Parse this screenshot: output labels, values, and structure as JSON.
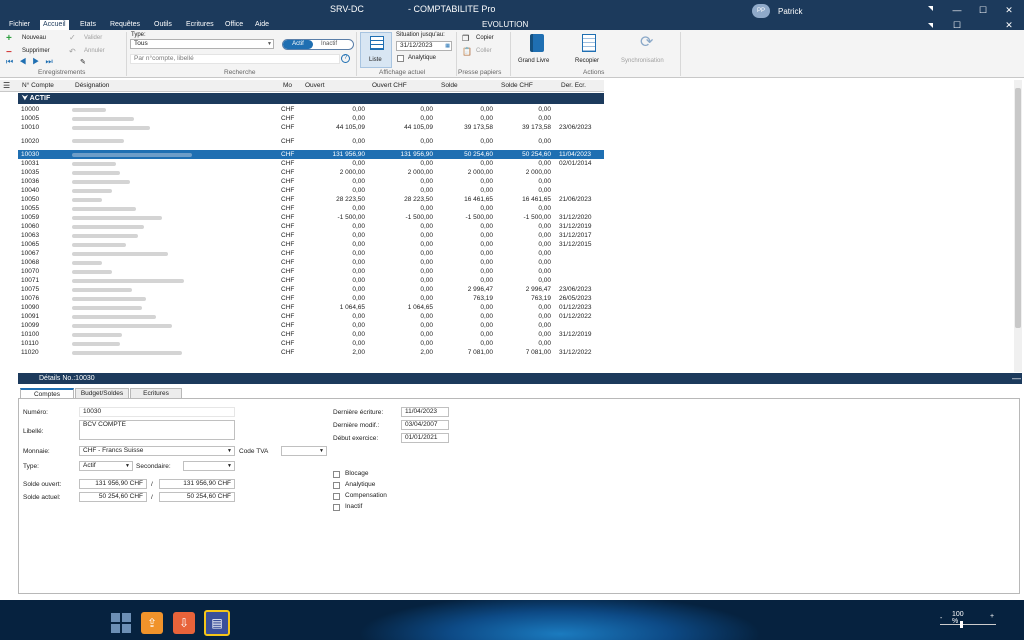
{
  "titlebar": {
    "server": "SRV-DC",
    "app_title": "- COMPTABILITE Pro",
    "user_initials": "PP",
    "user_name": "Patrick"
  },
  "menu": {
    "items": [
      "Fichier",
      "Accueil",
      "Etats",
      "Requêtes",
      "Outils",
      "Ecritures",
      "Office",
      "Aide"
    ],
    "active": "Accueil",
    "context": "EVOLUTION"
  },
  "ribbon": {
    "nouveau": "Nouveau",
    "supprimer": "Supprimer",
    "valider": "Valider",
    "annuler": "Annuler",
    "type_label": "Type:",
    "type_value": "Tous",
    "search_placeholder": "Par n°compte, libellé",
    "toggle_on": "Actif",
    "toggle_off": "Inactif",
    "liste": "Liste",
    "situation_label": "Situation jusqu'au:",
    "situation_date": "31/12/2023",
    "analytique": "Analytique",
    "copier": "Copier",
    "coller": "Coller",
    "grand_livre": "Grand Livre",
    "recopier": "Recopier",
    "synchronisation": "Synchronisation",
    "groups": {
      "enregistrements": "Enregistrements",
      "recherche": "Recherche",
      "affichage": "Affichage actuel",
      "presse": "Presse papiers",
      "actions": "Actions"
    }
  },
  "grid": {
    "columns": [
      "N° Compte",
      "Désignation",
      "Mo",
      "Ouvert",
      "Ouvert CHF",
      "Solde",
      "Solde CHF",
      "Der. Ecr."
    ],
    "group": "ACTIF",
    "rows": [
      {
        "num": "10000",
        "mo": "CHF",
        "ouvert": "0,00",
        "ouvert_chf": "0,00",
        "solde": "0,00",
        "solde_chf": "0,00",
        "der": ""
      },
      {
        "num": "10005",
        "mo": "CHF",
        "ouvert": "0,00",
        "ouvert_chf": "0,00",
        "solde": "0,00",
        "solde_chf": "0,00",
        "der": ""
      },
      {
        "num": "10010",
        "mo": "CHF",
        "ouvert": "44 105,09",
        "ouvert_chf": "44 105,09",
        "solde": "39 173,58",
        "solde_chf": "39 173,58",
        "der": "23/06/2023"
      },
      {
        "num": "10020",
        "mo": "CHF",
        "ouvert": "0,00",
        "ouvert_chf": "0,00",
        "solde": "0,00",
        "solde_chf": "0,00",
        "der": ""
      },
      {
        "num": "10030",
        "mo": "CHF",
        "ouvert": "131 956,90",
        "ouvert_chf": "131 956,90",
        "solde": "50 254,60",
        "solde_chf": "50 254,60",
        "der": "11/04/2023",
        "selected": true
      },
      {
        "num": "10031",
        "mo": "CHF",
        "ouvert": "0,00",
        "ouvert_chf": "0,00",
        "solde": "0,00",
        "solde_chf": "0,00",
        "der": "02/01/2014"
      },
      {
        "num": "10035",
        "mo": "CHF",
        "ouvert": "2 000,00",
        "ouvert_chf": "2 000,00",
        "solde": "2 000,00",
        "solde_chf": "2 000,00",
        "der": ""
      },
      {
        "num": "10036",
        "mo": "CHF",
        "ouvert": "0,00",
        "ouvert_chf": "0,00",
        "solde": "0,00",
        "solde_chf": "0,00",
        "der": ""
      },
      {
        "num": "10040",
        "mo": "CHF",
        "ouvert": "0,00",
        "ouvert_chf": "0,00",
        "solde": "0,00",
        "solde_chf": "0,00",
        "der": ""
      },
      {
        "num": "10050",
        "mo": "CHF",
        "ouvert": "28 223,50",
        "ouvert_chf": "28 223,50",
        "solde": "16 461,65",
        "solde_chf": "16 461,65",
        "der": "21/06/2023"
      },
      {
        "num": "10055",
        "mo": "CHF",
        "ouvert": "0,00",
        "ouvert_chf": "0,00",
        "solde": "0,00",
        "solde_chf": "0,00",
        "der": ""
      },
      {
        "num": "10059",
        "mo": "CHF",
        "ouvert": "-1 500,00",
        "ouvert_chf": "-1 500,00",
        "solde": "-1 500,00",
        "solde_chf": "-1 500,00",
        "der": "31/12/2020"
      },
      {
        "num": "10060",
        "mo": "CHF",
        "ouvert": "0,00",
        "ouvert_chf": "0,00",
        "solde": "0,00",
        "solde_chf": "0,00",
        "der": "31/12/2019"
      },
      {
        "num": "10063",
        "mo": "CHF",
        "ouvert": "0,00",
        "ouvert_chf": "0,00",
        "solde": "0,00",
        "solde_chf": "0,00",
        "der": "31/12/2017"
      },
      {
        "num": "10065",
        "mo": "CHF",
        "ouvert": "0,00",
        "ouvert_chf": "0,00",
        "solde": "0,00",
        "solde_chf": "0,00",
        "der": "31/12/2015"
      },
      {
        "num": "10067",
        "mo": "CHF",
        "ouvert": "0,00",
        "ouvert_chf": "0,00",
        "solde": "0,00",
        "solde_chf": "0,00",
        "der": ""
      },
      {
        "num": "10068",
        "mo": "CHF",
        "ouvert": "0,00",
        "ouvert_chf": "0,00",
        "solde": "0,00",
        "solde_chf": "0,00",
        "der": ""
      },
      {
        "num": "10070",
        "mo": "CHF",
        "ouvert": "0,00",
        "ouvert_chf": "0,00",
        "solde": "0,00",
        "solde_chf": "0,00",
        "der": ""
      },
      {
        "num": "10071",
        "mo": "CHF",
        "ouvert": "0,00",
        "ouvert_chf": "0,00",
        "solde": "0,00",
        "solde_chf": "0,00",
        "der": ""
      },
      {
        "num": "10075",
        "mo": "CHF",
        "ouvert": "0,00",
        "ouvert_chf": "0,00",
        "solde": "2 996,47",
        "solde_chf": "2 996,47",
        "der": "23/06/2023"
      },
      {
        "num": "10076",
        "mo": "CHF",
        "ouvert": "0,00",
        "ouvert_chf": "0,00",
        "solde": "763,19",
        "solde_chf": "763,19",
        "der": "26/05/2023"
      },
      {
        "num": "10090",
        "mo": "CHF",
        "ouvert": "1 064,65",
        "ouvert_chf": "1 064,65",
        "solde": "0,00",
        "solde_chf": "0,00",
        "der": "01/12/2023"
      },
      {
        "num": "10091",
        "mo": "CHF",
        "ouvert": "0,00",
        "ouvert_chf": "0,00",
        "solde": "0,00",
        "solde_chf": "0,00",
        "der": "01/12/2022"
      },
      {
        "num": "10099",
        "mo": "CHF",
        "ouvert": "0,00",
        "ouvert_chf": "0,00",
        "solde": "0,00",
        "solde_chf": "0,00",
        "der": ""
      },
      {
        "num": "10100",
        "mo": "CHF",
        "ouvert": "0,00",
        "ouvert_chf": "0,00",
        "solde": "0,00",
        "solde_chf": "0,00",
        "der": "31/12/2019"
      },
      {
        "num": "10110",
        "mo": "CHF",
        "ouvert": "0,00",
        "ouvert_chf": "0,00",
        "solde": "0,00",
        "solde_chf": "0,00",
        "der": ""
      },
      {
        "num": "11020",
        "mo": "CHF",
        "ouvert": "2,00",
        "ouvert_chf": "2,00",
        "solde": "7 081,00",
        "solde_chf": "7 081,00",
        "der": "31/12/2022"
      }
    ]
  },
  "details": {
    "header": "Détails No.:10030",
    "tabs": [
      "Comptes",
      "Budget/Soldes",
      "Ecritures"
    ],
    "numero_label": "Numéro:",
    "numero": "10030",
    "libelle_label": "Libellé:",
    "libelle": "BCV COMPTE",
    "monnaie_label": "Monnaie:",
    "monnaie": "CHF - Francs Suisse",
    "code_tva_label": "Code TVA",
    "type_label": "Type:",
    "type": "Actif",
    "secondaire_label": "Secondaire:",
    "solde_ouvert_label": "Solde ouvert:",
    "solde_ouvert_1": "131 956,90 CHF",
    "solde_ouvert_2": "131 956,90 CHF",
    "solde_actuel_label": "Solde actuel:",
    "solde_actuel_1": "50 254,60 CHF",
    "solde_actuel_2": "50 254,60 CHF",
    "slash": "/",
    "derniere_ecriture_label": "Dernière écriture:",
    "derniere_ecriture": "11/04/2023",
    "derniere_modif_label": "Dernière modif.:",
    "derniere_modif": "03/04/2007",
    "debut_exercice_label": "Début exercice:",
    "debut_exercice": "01/01/2021",
    "checks": [
      "Blocage",
      "Analytique",
      "Compensation",
      "Inactif"
    ]
  },
  "taskbar": {
    "zoom": "100 %",
    "zoom_minus": "-",
    "zoom_plus": "+"
  },
  "colors": {
    "navy": "#1c3a5c",
    "selection": "#1f6fb2",
    "orange": "#f0932b",
    "red_orange": "#e8633a"
  }
}
